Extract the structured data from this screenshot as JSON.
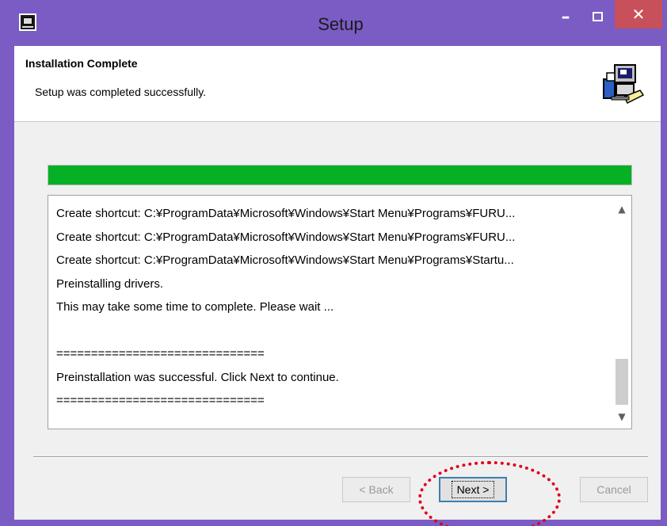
{
  "window": {
    "title": "Setup",
    "icon": "setup-app-icon",
    "controls": [
      "minimize-icon",
      "maximize-icon",
      "close-icon"
    ]
  },
  "header": {
    "heading": "Installation Complete",
    "subheading": "Setup was completed successfully.",
    "icon": "computer-setup-icon"
  },
  "progress": {
    "value": 1.0,
    "color": "#06b025"
  },
  "log": {
    "lines": [
      "Create shortcut: C:¥ProgramData¥Microsoft¥Windows¥Start Menu¥Programs¥FURU...",
      "Create shortcut: C:¥ProgramData¥Microsoft¥Windows¥Start Menu¥Programs¥FURU...",
      "Create shortcut: C:¥ProgramData¥Microsoft¥Windows¥Start Menu¥Programs¥Startu...",
      "Preinstalling drivers.",
      "This may take some time to complete. Please wait ...",
      "",
      "==============================",
      "Preinstallation was successful. Click Next to continue.",
      "=============================="
    ]
  },
  "buttons": {
    "back": "< Back",
    "next": "Next >",
    "cancel": "Cancel"
  },
  "colors": {
    "frame": "#7a5cc4",
    "close": "#c8505a",
    "highlight": "#e0001b"
  }
}
